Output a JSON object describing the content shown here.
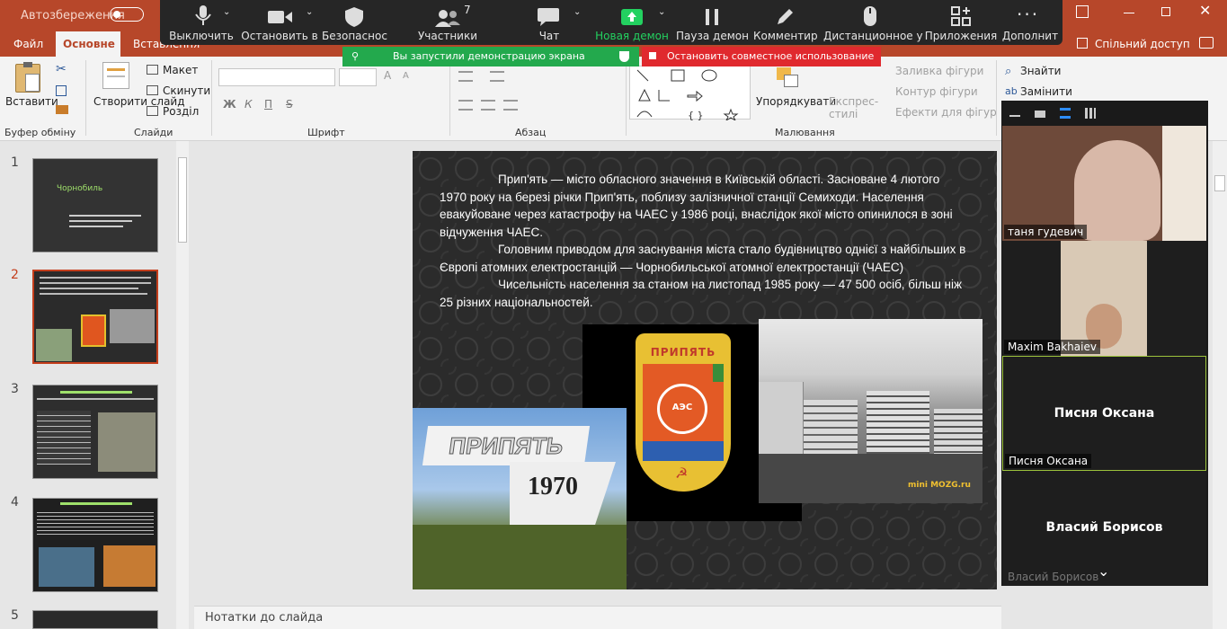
{
  "titlebar": {
    "autosave_label": "Автозбереження",
    "share_label": "Спільний доступ"
  },
  "ribbon_tabs": [
    "Файл",
    "Основне",
    "Вставлення"
  ],
  "ribbon": {
    "paste": "Вставити",
    "clipboard_group": "Буфер обміну",
    "new_slide": "Створити слайд",
    "layout": "Макет",
    "reset": "Скинути",
    "section": "Розділ",
    "slides_group": "Слайди",
    "font_group": "Шрифт",
    "paragraph_group": "Абзац",
    "arrange": "Упорядкувати",
    "quick_styles": "Експрес-стилі",
    "shape_fill": "Заливка фігури",
    "shape_outline": "Контур фігури",
    "shape_effects": "Ефекти для фігур",
    "drawing_group": "Малювання",
    "find": "Знайти",
    "replace": "Замінити",
    "bold": "Ж",
    "italic": "К",
    "underline": "П",
    "strike": "S"
  },
  "zoom_toolbar": {
    "items": [
      {
        "label": "Выключить"
      },
      {
        "label": "Остановить в"
      },
      {
        "label": "Безопаснос"
      },
      {
        "label": "Участники",
        "count": "7"
      },
      {
        "label": "Чат"
      },
      {
        "label": "Новая демон"
      },
      {
        "label": "Пауза демон"
      },
      {
        "label": "Комментир"
      },
      {
        "label": "Дистанционное у"
      },
      {
        "label": "Приложения"
      },
      {
        "label": "Дополнит"
      }
    ],
    "sharing_banner": "Вы запустили демонстрацию экрана",
    "stop_button": "Остановить совместное использование"
  },
  "thumbnails": [
    {
      "num": "1",
      "title": "Чорнобиль"
    },
    {
      "num": "2"
    },
    {
      "num": "3"
    },
    {
      "num": "4"
    },
    {
      "num": "5"
    }
  ],
  "slide": {
    "para1": "Прип'ять — місто обласного значення в Київській області. Засноване 4 лютого 1970 року на березі річки Прип'ять, поблизу залізничної станції Семиходи. Населення евакуйоване через катастрофу на ЧАЕС у 1986 році, внаслідок якої місто опинилося в зоні відчуження ЧАЕС.",
    "para2": "Головним приводом для заснування міста стало будівництво однієї з найбільших в Європі атомних електростанцій — Чорнобильської атомної електростанції (ЧАЕС)",
    "para3": "Чисельність населення за станом на листопад 1985 року — 47 500 осіб, більш ніж 25 різних національностей.",
    "sign_word": "ПРИПЯТЬ",
    "sign_year": "1970",
    "emblem_text": "ПРИПЯТЬ",
    "emblem_center": "АЭС",
    "watermark": "mini MOZG.ru"
  },
  "notes_placeholder": "Нотатки до слайда",
  "participants": [
    {
      "name": "таня гудевич"
    },
    {
      "name": "Maxim Bakhaiev"
    },
    {
      "name": "Писня Оксана",
      "center": "Писня Оксана"
    },
    {
      "name": "Власий Борисов",
      "center": "Власий Борисов"
    }
  ]
}
